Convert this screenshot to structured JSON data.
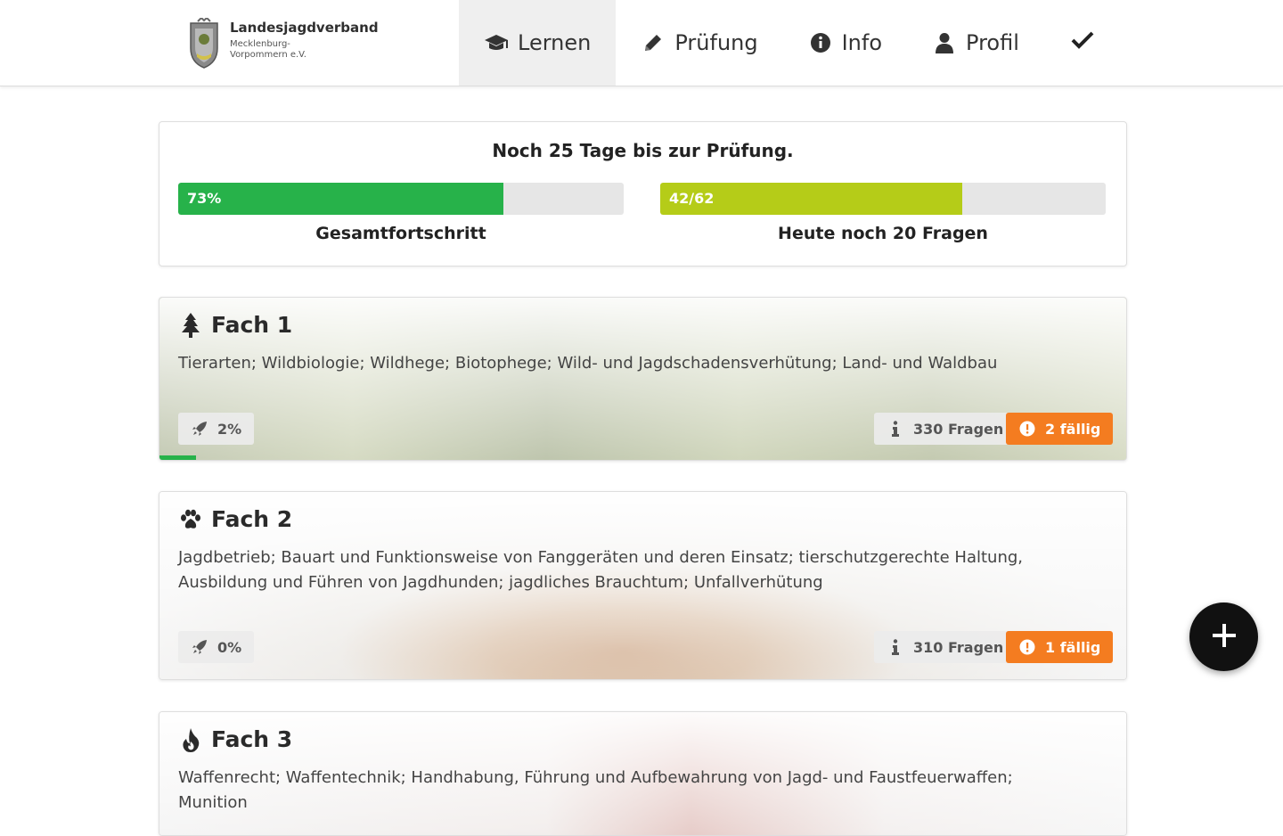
{
  "header": {
    "org_name": "Landesjagdverband",
    "org_sub": "Mecklenburg-Vorpommern e.V.",
    "nav": [
      {
        "label": "Lernen",
        "icon": "graduation-cap-icon",
        "active": true
      },
      {
        "label": "Prüfung",
        "icon": "pencil-icon",
        "active": false
      },
      {
        "label": "Info",
        "icon": "info-circle-icon",
        "active": false
      },
      {
        "label": "Profil",
        "icon": "user-icon",
        "active": false
      }
    ],
    "check_icon": "check-icon"
  },
  "progress": {
    "countdown": "Noch 25 Tage bis zur Prüfung.",
    "total": {
      "text": "73%",
      "fraction": 0.73,
      "caption": "Gesamtfortschritt",
      "color": "#27b24a"
    },
    "today": {
      "text": "42/62",
      "fraction": 0.677,
      "caption": "Heute noch 20 Fragen",
      "color": "#b5cc18"
    }
  },
  "subjects": [
    {
      "title": "Fach 1",
      "icon": "tree-icon",
      "description": "Tierarten; Wildbiologie; Wildhege; Biotophege; Wild- und Jagdschadensverhütung; Land- und Waldbau",
      "progress_text": "2%",
      "progress_fraction": 0.02,
      "questions": "330 Fragen",
      "due": "2 fällig"
    },
    {
      "title": "Fach 2",
      "icon": "paw-icon",
      "description": "Jagdbetrieb; Bauart und Funktionsweise von Fanggeräten und deren Einsatz; tierschutzgerechte Haltung, Ausbildung und Führen von Jagdhunden; jagdliches Brauchtum; Unfallverhütung",
      "progress_text": "0%",
      "progress_fraction": 0.0,
      "questions": "310 Fragen",
      "due": "1 fällig"
    },
    {
      "title": "Fach 3",
      "icon": "fire-icon",
      "description": "Waffenrecht; Waffentechnik; Handhabung, Führung und Aufbewahrung von Jagd- und Faustfeuerwaffen; Munition"
    }
  ],
  "colors": {
    "accent_green": "#27b24a",
    "accent_lime": "#b5cc18",
    "due_orange": "#f47c20"
  }
}
